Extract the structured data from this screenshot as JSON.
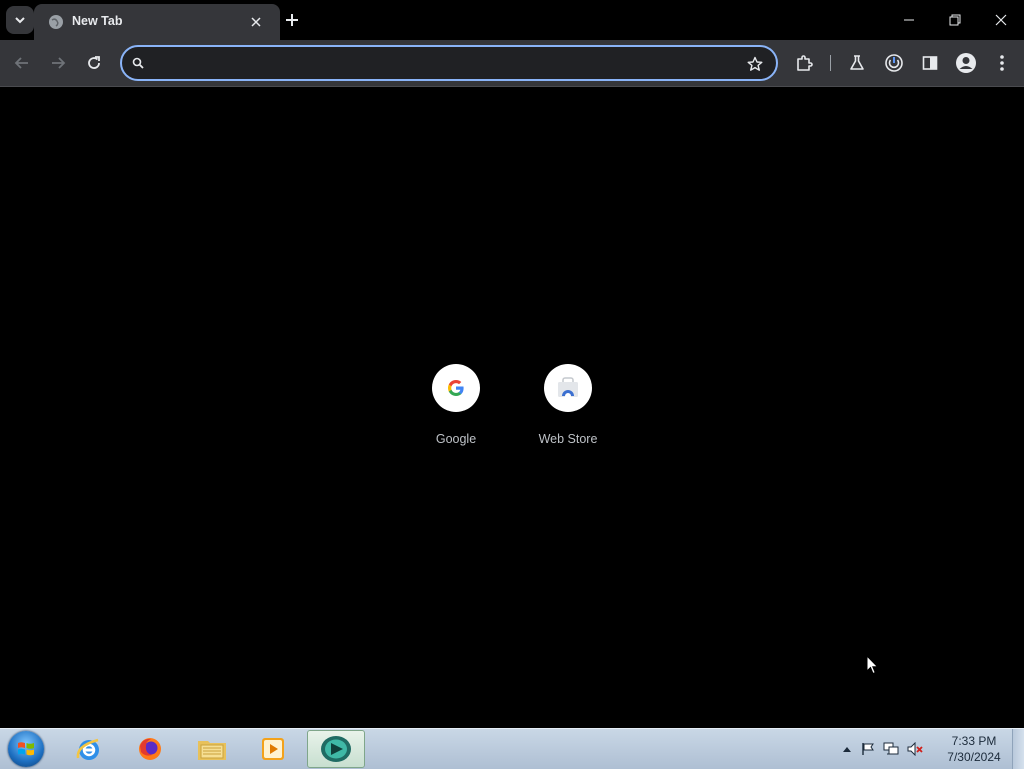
{
  "browser": {
    "tab": {
      "title": "New Tab"
    },
    "omnibox": {
      "value": "",
      "placeholder": ""
    }
  },
  "ntp": {
    "shortcuts": [
      {
        "label": "Google",
        "icon": "google-g-icon"
      },
      {
        "label": "Web Store",
        "icon": "web-store-icon"
      }
    ]
  },
  "taskbar": {
    "apps": [
      "internet-explorer-icon",
      "firefox-icon",
      "file-explorer-icon",
      "media-player-icon",
      "chrome-browser-icon"
    ],
    "clock": {
      "time": "7:33 PM",
      "date": "7/30/2024"
    }
  },
  "colors": {
    "background": "#000000",
    "toolbar": "#35363a",
    "omnibox_focus": "#8ab4f8",
    "taskbar": "#c9d7e6"
  }
}
